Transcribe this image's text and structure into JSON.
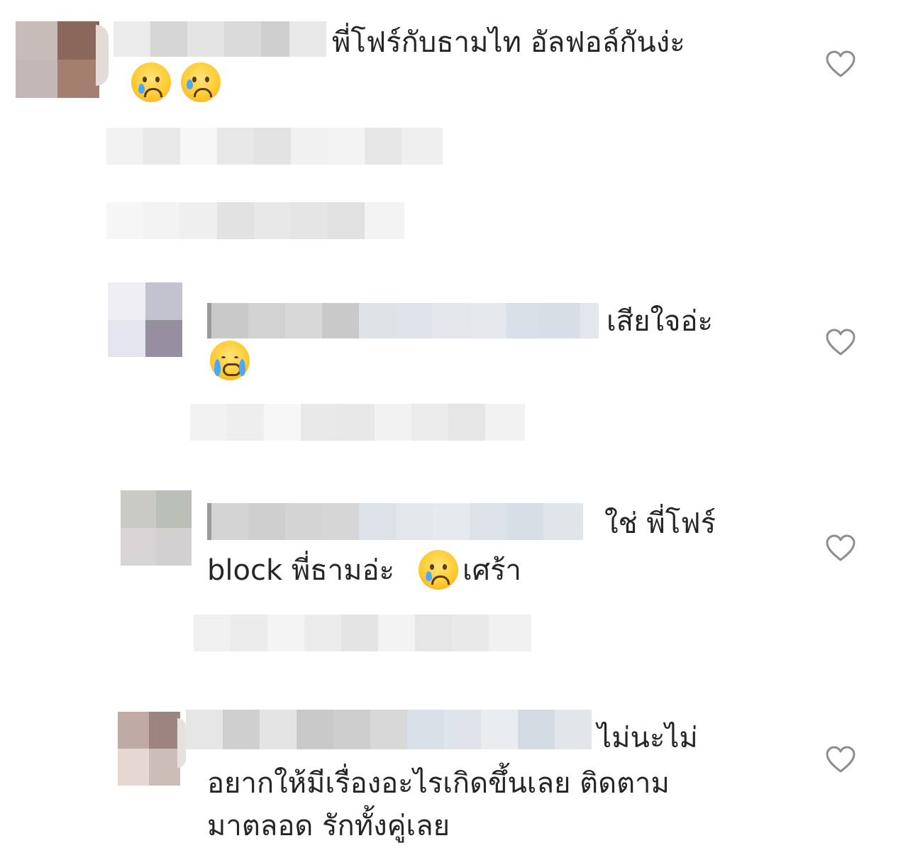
{
  "comments": [
    {
      "text_line1": "พี่โฟร์กับธามไท อัลฟอล์กันง่ะ",
      "emoji": [
        "crying-face",
        "sad-relieved-face"
      ]
    },
    {
      "text_line1": "เสียใจอ่ะ",
      "emoji": [
        "loudly-crying-face"
      ]
    },
    {
      "text_line1": "ใช่ พี่โฟร์",
      "text_line2a": "block พี่ธามอ่ะ",
      "text_line2b": "เศร้า",
      "emoji": [
        "crying-face"
      ]
    },
    {
      "text_line1": "ไม่นะไม่",
      "text_line2": "อยากให้มีเรื่องอะไรเกิดขึ้นเลย ติดตาม",
      "text_line3": "มาตลอด รักทั้งคู่เลย"
    }
  ],
  "icons": {
    "like": "heart-outline-icon"
  },
  "colors": {
    "text": "#262626",
    "heart": "#8e8e8e"
  }
}
